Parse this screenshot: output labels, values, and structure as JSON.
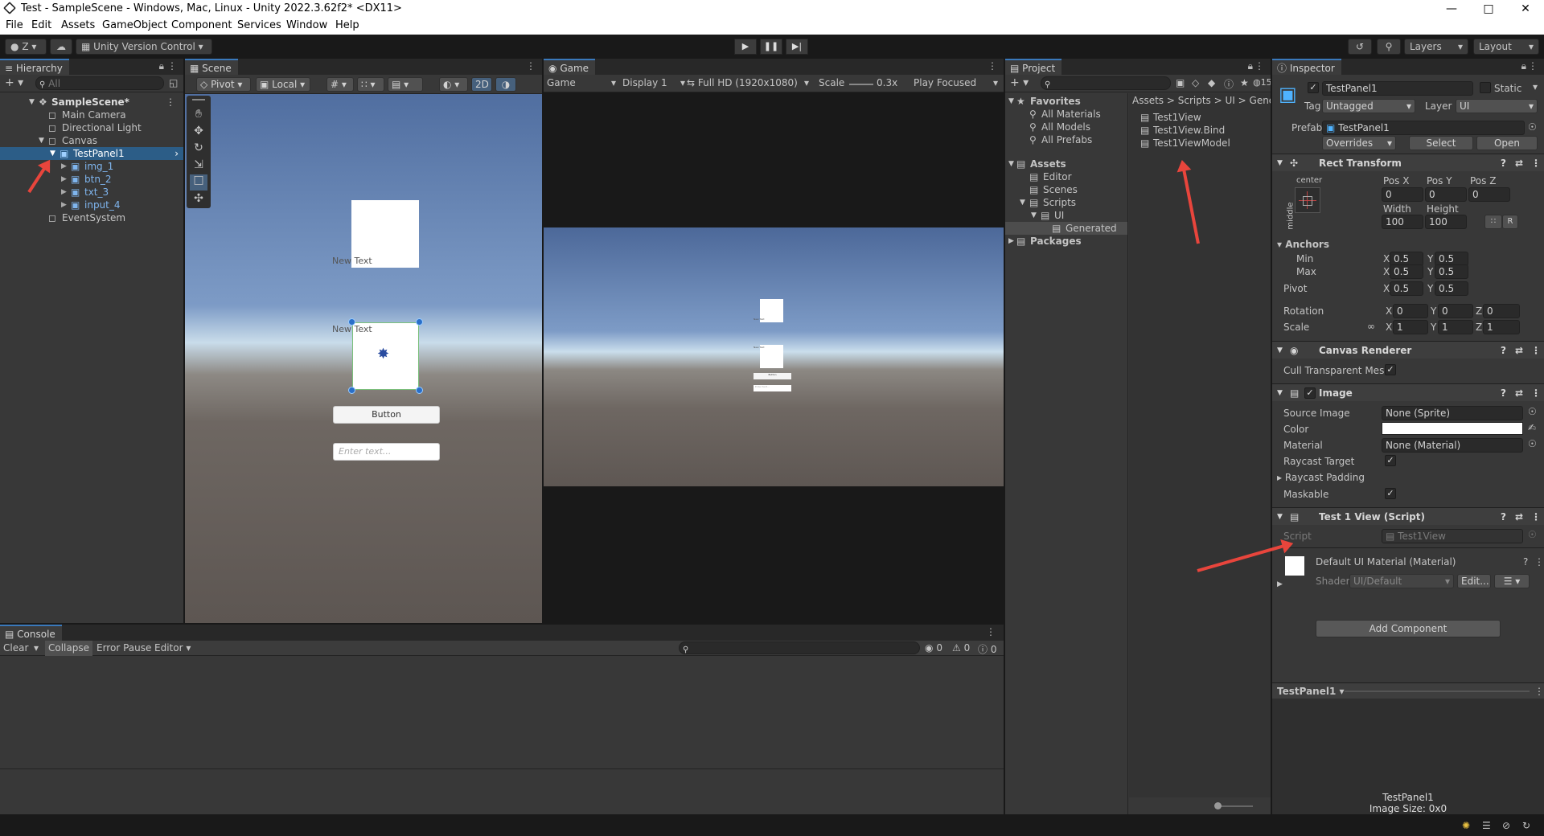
{
  "window": {
    "title": "Test - SampleScene - Windows, Mac, Linux - Unity 2022.3.62f2* <DX11>"
  },
  "menu": [
    "File",
    "Edit",
    "Assets",
    "GameObject",
    "Component",
    "Services",
    "Window",
    "Help"
  ],
  "toolbar": {
    "account": "Z",
    "vcs": "Unity Version Control",
    "layers": "Layers",
    "layout": "Layout"
  },
  "hierarchy": {
    "tab": "Hierarchy",
    "search_placeholder": "All",
    "items": [
      "SampleScene*",
      "Main Camera",
      "Directional Light",
      "Canvas",
      "TestPanel1",
      "img_1",
      "btn_2",
      "txt_3",
      "input_4",
      "EventSystem"
    ]
  },
  "scene": {
    "tab": "Scene",
    "pivot": "Pivot",
    "local": "Local",
    "mode_2d": "2D",
    "text1": "New Text",
    "text2": "New Text",
    "button": "Button",
    "input_placeholder": "Enter text..."
  },
  "game": {
    "tab": "Game",
    "view": "Game",
    "display": "Display 1",
    "resolution": "Full HD (1920x1080)",
    "scale_label": "Scale",
    "scale_value": "0.3x",
    "play_focused": "Play Focused",
    "tiny_text1": "New Text",
    "tiny_text2": "New Text",
    "tiny_button": "Button",
    "tiny_input": "Enter text..."
  },
  "project": {
    "tab": "Project",
    "count": "15",
    "favorites_label": "Favorites",
    "favorites": [
      "All Materials",
      "All Models",
      "All Prefabs"
    ],
    "assets_label": "Assets",
    "folders": [
      "Editor",
      "Scenes",
      "Scripts",
      "UI",
      "Generated"
    ],
    "packages": "Packages",
    "breadcrumb": [
      "Assets",
      "Scripts",
      "UI",
      "Gene"
    ],
    "files": [
      "Test1View",
      "Test1View.Bind",
      "Test1ViewModel"
    ]
  },
  "inspector": {
    "tab": "Inspector",
    "name": "TestPanel1",
    "static": "Static",
    "tag_label": "Tag",
    "tag": "Untagged",
    "layer_label": "Layer",
    "layer": "UI",
    "prefab_label": "Prefab",
    "prefab": "TestPanel1",
    "overrides": "Overrides",
    "select": "Select",
    "open": "Open",
    "rect": {
      "title": "Rect Transform",
      "anchor_h": "center",
      "anchor_v": "middle",
      "posx_l": "Pos X",
      "posy_l": "Pos Y",
      "posz_l": "Pos Z",
      "posx": "0",
      "posy": "0",
      "posz": "0",
      "width_l": "Width",
      "height_l": "Height",
      "width": "100",
      "height": "100",
      "anchors": "Anchors",
      "min": "Min",
      "max": "Max",
      "pivot": "Pivot",
      "min_x": "0.5",
      "min_y": "0.5",
      "max_x": "0.5",
      "max_y": "0.5",
      "pivot_x": "0.5",
      "pivot_y": "0.5",
      "rotation": "Rotation",
      "scale": "Scale",
      "rot_x": "0",
      "rot_y": "0",
      "rot_z": "0",
      "sc_x": "1",
      "sc_y": "1",
      "sc_z": "1",
      "x": "X",
      "y": "Y",
      "z": "Z",
      "r": "R"
    },
    "canvas_renderer": {
      "title": "Canvas Renderer",
      "cull": "Cull Transparent Mes"
    },
    "image": {
      "title": "Image",
      "source_image_l": "Source Image",
      "source_image": "None (Sprite)",
      "color_l": "Color",
      "material_l": "Material",
      "material": "None (Material)",
      "raycast_target": "Raycast Target",
      "raycast_padding": "Raycast Padding",
      "maskable": "Maskable"
    },
    "script_comp": {
      "title": "Test 1 View (Script)",
      "script_l": "Script",
      "script": "Test1View"
    },
    "material": {
      "title": "Default UI Material (Material)",
      "shader_l": "Shader",
      "shader": "UI/Default",
      "edit": "Edit..."
    },
    "add_component": "Add Component",
    "preview_title": "TestPanel1",
    "preview_name": "TestPanel1",
    "preview_size": "Image Size: 0x0"
  },
  "console": {
    "tab": "Console",
    "clear": "Clear",
    "collapse": "Collapse",
    "error_pause": "Error Pause",
    "editor": "Editor",
    "info_count": "0",
    "warn_count": "0",
    "error_count": "0"
  },
  "colors": {
    "accent": "#2c5d87",
    "selection": "#2c5d87",
    "prefab_blue": "#7fb5ee",
    "arrow": "#e8453c"
  }
}
